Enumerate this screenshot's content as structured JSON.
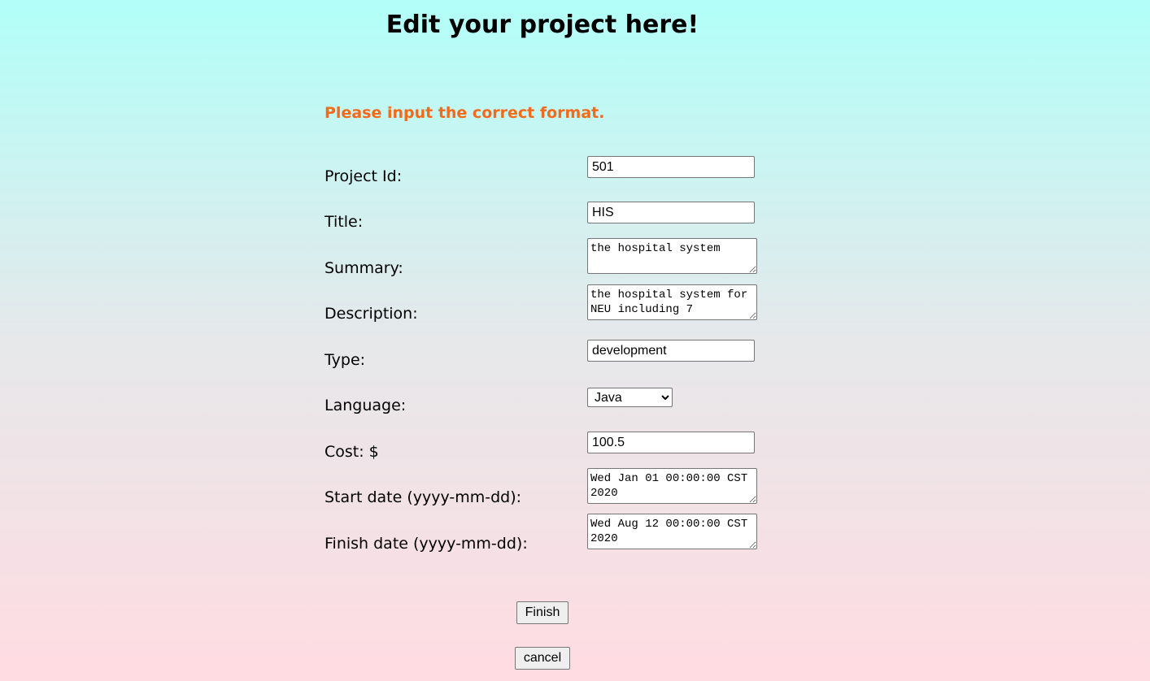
{
  "page": {
    "title": "Edit your project here!",
    "error_message": "Please input the correct format."
  },
  "form": {
    "project_id": {
      "label": "Project Id:",
      "value": "501"
    },
    "title": {
      "label": "Title:",
      "value": "HIS"
    },
    "summary": {
      "label": "Summary:",
      "value": "the hospital system"
    },
    "description": {
      "label": "Description:",
      "value": "the hospital system for NEU including 7"
    },
    "type": {
      "label": "Type:",
      "value": "development"
    },
    "language": {
      "label": "Language:",
      "selected": "Java"
    },
    "cost": {
      "label": "Cost: $",
      "value": "100.5"
    },
    "start_date": {
      "label": "Start date (yyyy-mm-dd):",
      "value": "Wed Jan 01 00:00:00 CST 2020"
    },
    "finish_date": {
      "label": "Finish date (yyyy-mm-dd):",
      "value": "Wed Aug 12 00:00:00 CST 2020"
    }
  },
  "buttons": {
    "finish": "Finish",
    "cancel": "cancel"
  },
  "colors": {
    "error": "#f26a1b",
    "background_top": "#b2fff9",
    "background_bottom": "#ffdce2"
  }
}
